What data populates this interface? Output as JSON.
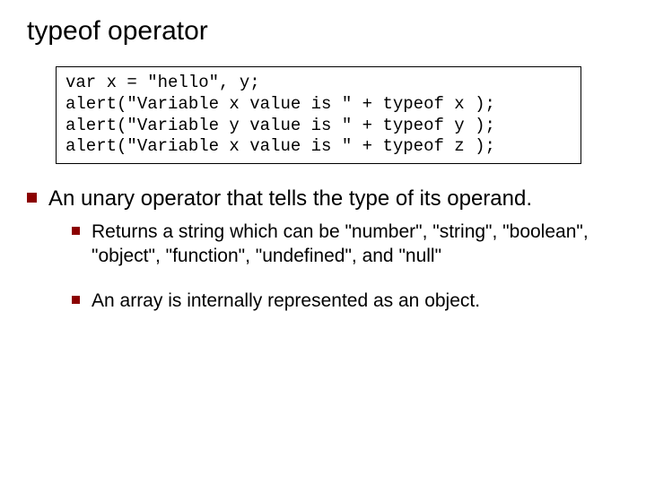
{
  "title": "typeof operator",
  "code": {
    "line1": "var x = \"hello\", y;",
    "line2": "alert(\"Variable x value is \" + typeof x );",
    "line3": "alert(\"Variable y value is \" + typeof y );",
    "line4": "alert(\"Variable x value is \" + typeof z );"
  },
  "bullets": {
    "top1": "An unary operator that tells the type of its operand.",
    "sub1": "Returns a string which can be \"number\", \"string\", \"boolean\", \"object\", \"function\", \"undefined\", and \"null\"",
    "sub2": "An array is internally represented as an object."
  }
}
